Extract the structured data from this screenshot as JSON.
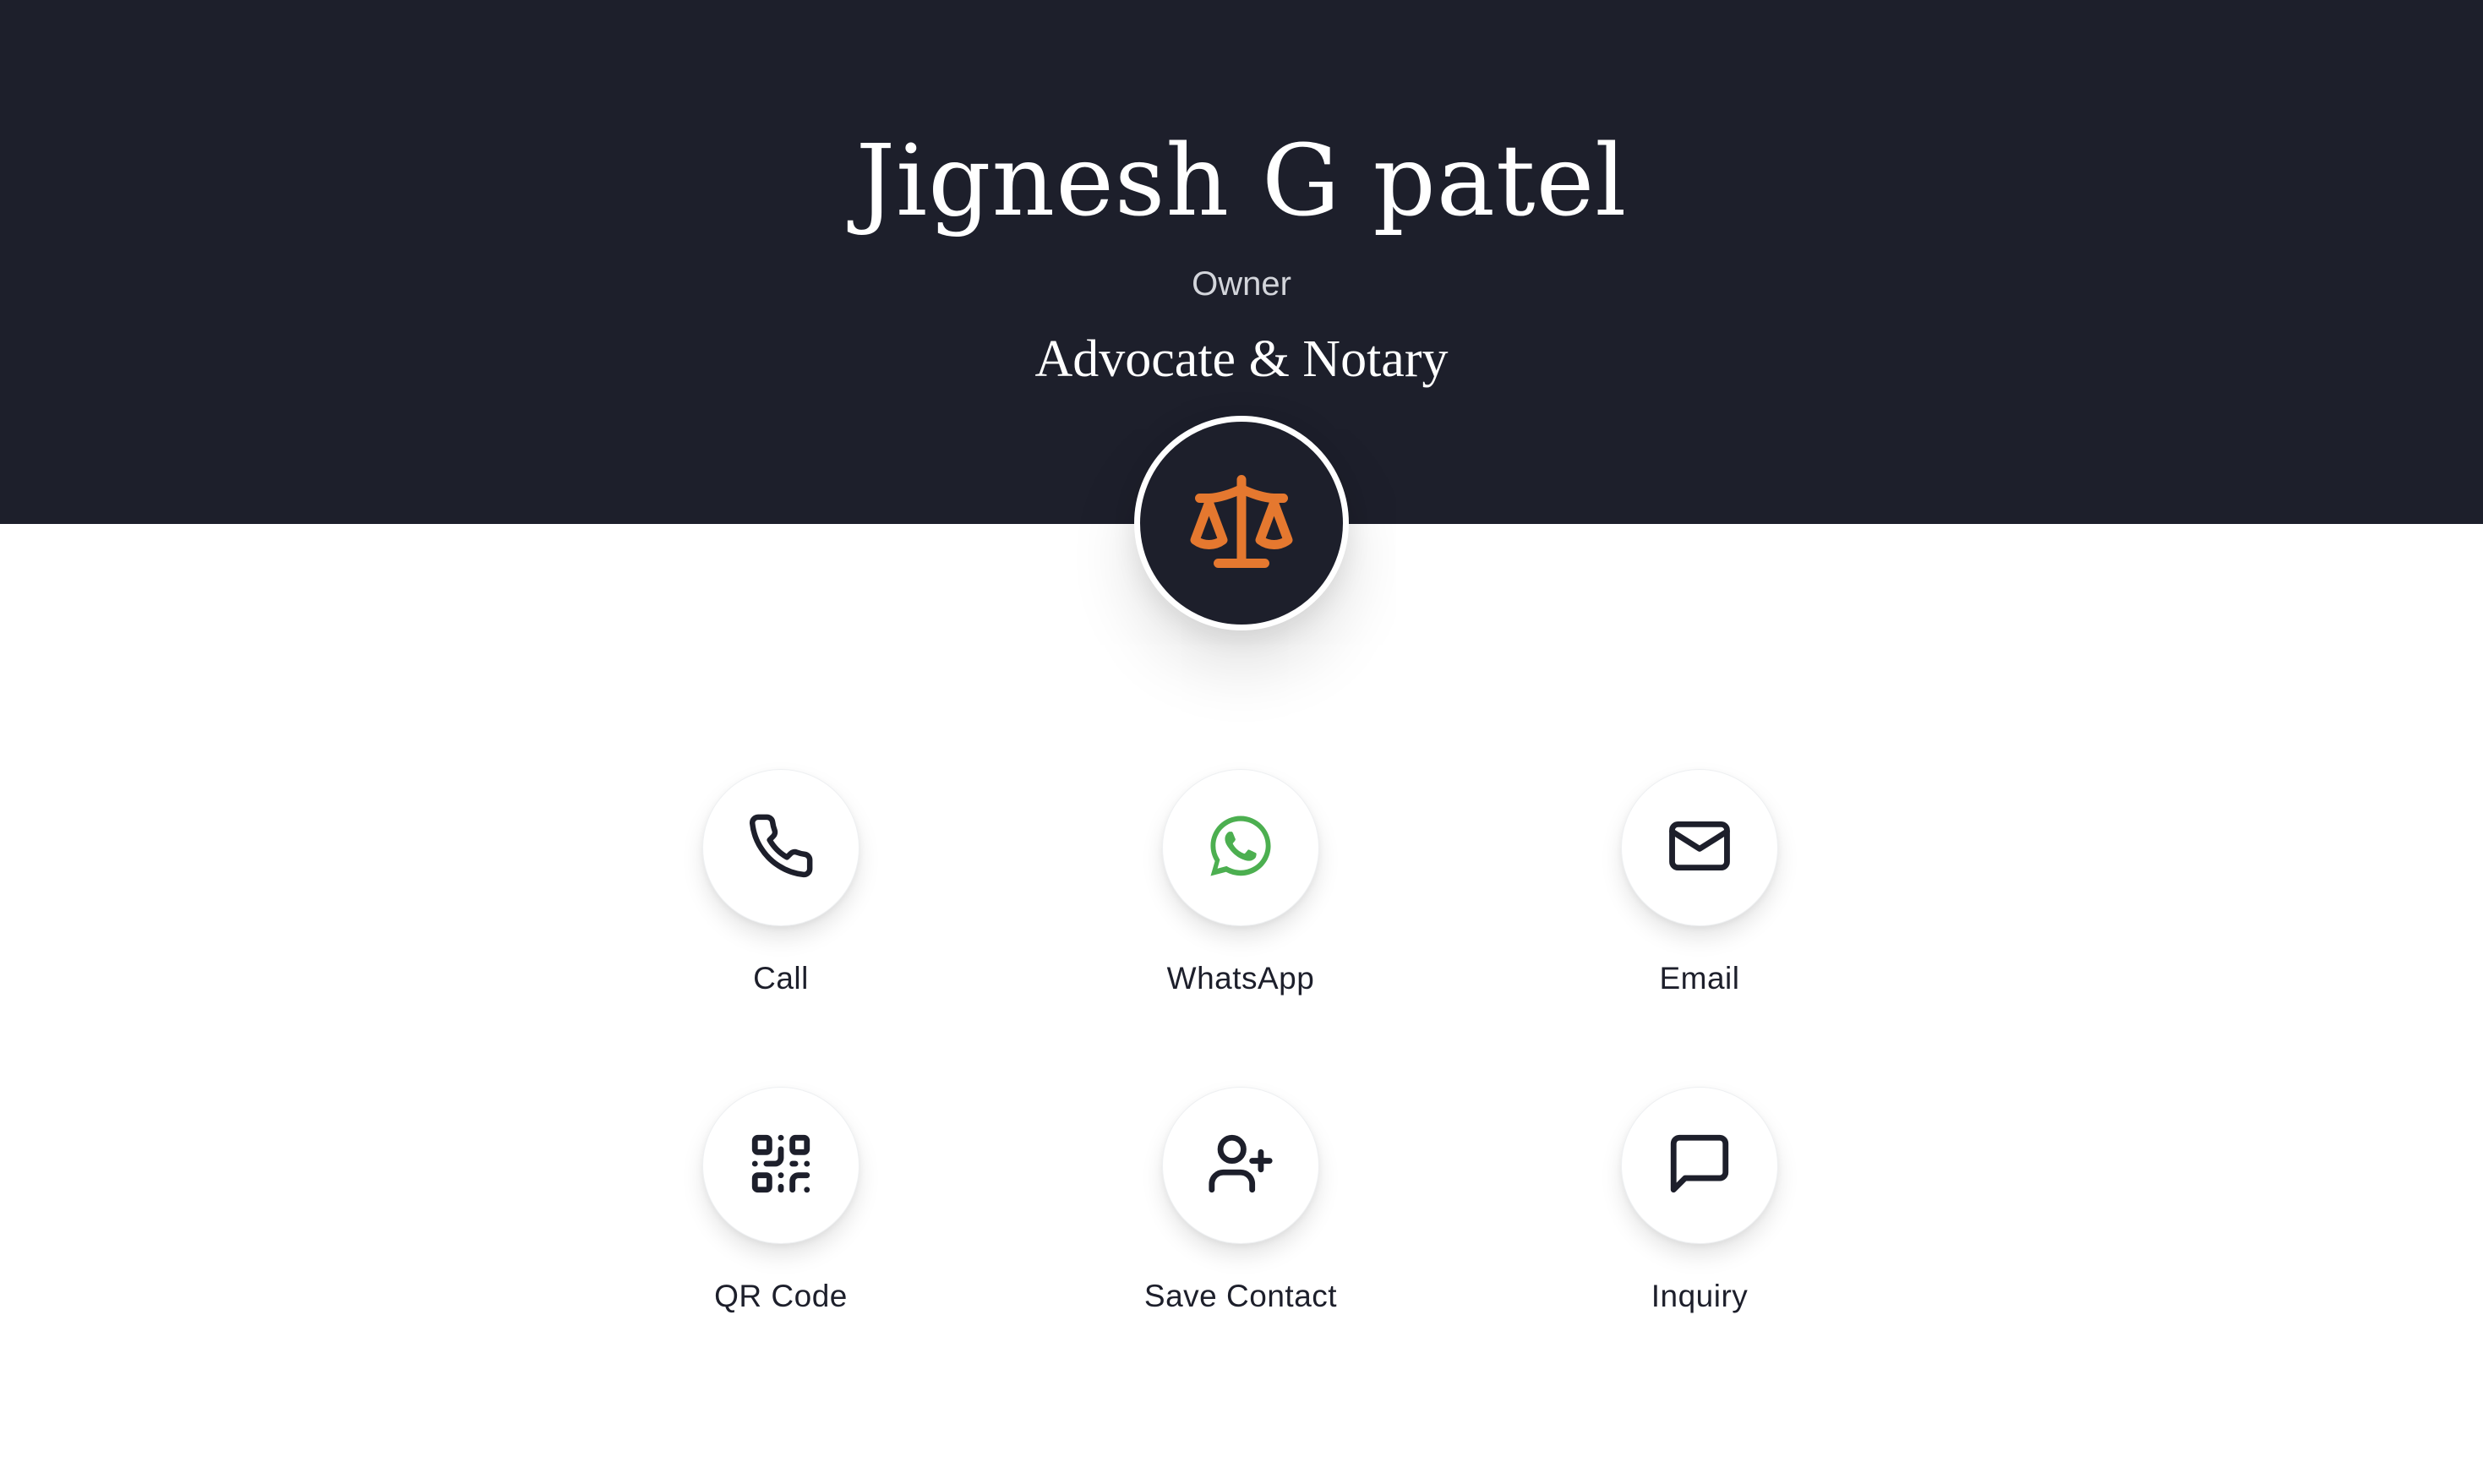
{
  "profile": {
    "name": "Jignesh G patel",
    "role": "Owner",
    "profession": "Advocate & Notary",
    "logo_icon": "scales-of-justice-icon"
  },
  "actions": [
    {
      "label": "Call",
      "icon": "phone-icon"
    },
    {
      "label": "WhatsApp",
      "icon": "whatsapp-icon"
    },
    {
      "label": "Email",
      "icon": "mail-icon"
    },
    {
      "label": "QR Code",
      "icon": "qr-code-icon"
    },
    {
      "label": "Save Contact",
      "icon": "user-plus-icon"
    },
    {
      "label": "Inquiry",
      "icon": "message-square-icon"
    }
  ],
  "colors": {
    "header_bg": "#1d1f2b",
    "accent_orange": "#e5782f",
    "whatsapp_green": "#4caf50",
    "icon_dark": "#1d1f2b"
  }
}
